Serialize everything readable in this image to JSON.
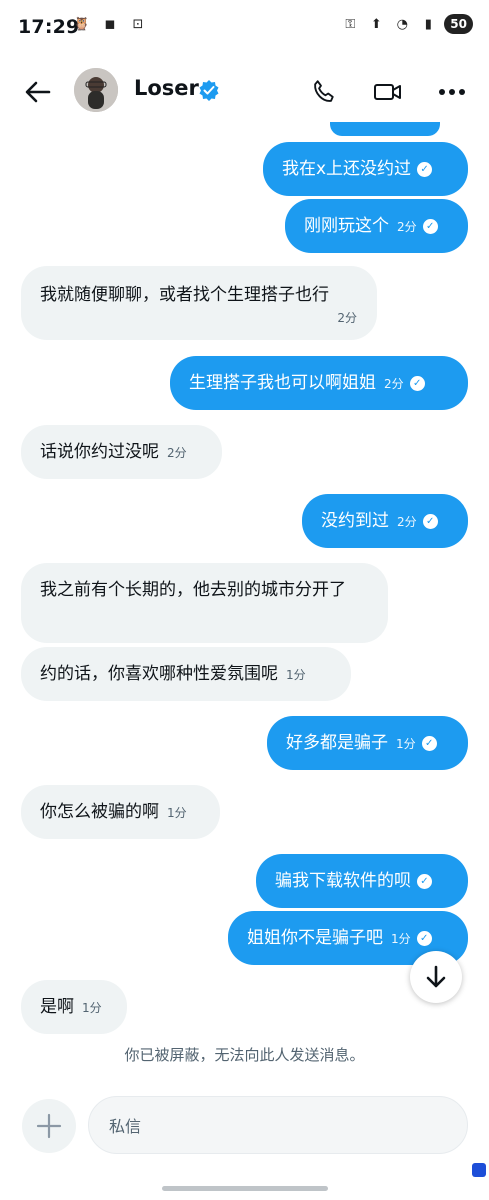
{
  "status_bar": {
    "time": "17:29",
    "battery": "50"
  },
  "header": {
    "contact_name": "Loser"
  },
  "messages": [
    {
      "dir": "out",
      "text": "我在x上还没约过",
      "time": "",
      "check": true
    },
    {
      "dir": "out",
      "text": "刚刚玩这个",
      "time": "2分",
      "check": true
    },
    {
      "dir": "in",
      "text": "我就随便聊聊，或者找个生理搭子也行",
      "time": "2分"
    },
    {
      "dir": "out",
      "text": "生理搭子我也可以啊姐姐",
      "time": "2分",
      "check": true
    },
    {
      "dir": "in",
      "text": "话说你约过没呢",
      "time": "2分"
    },
    {
      "dir": "out",
      "text": "没约到过",
      "time": "2分",
      "check": true
    },
    {
      "dir": "in",
      "text": "我之前有个长期的，他去别的城市分开了",
      "time": ""
    },
    {
      "dir": "in",
      "text": "约的话，你喜欢哪种性爱氛围呢",
      "time": "1分"
    },
    {
      "dir": "out",
      "text": "好多都是骗子",
      "time": "1分",
      "check": true
    },
    {
      "dir": "in",
      "text": "你怎么被骗的啊",
      "time": "1分"
    },
    {
      "dir": "out",
      "text": "骗我下载软件的呗",
      "time": "",
      "check": true
    },
    {
      "dir": "out",
      "text": "姐姐你不是骗子吧",
      "time": "1分",
      "check": true
    },
    {
      "dir": "in",
      "text": "是啊",
      "time": "1分"
    }
  ],
  "notice": "你已被屏蔽，无法向此人发送消息。",
  "composer": {
    "placeholder": "私信"
  },
  "colors": {
    "accent": "#1d9bf0",
    "incoming_bubble": "#eff3f4"
  }
}
